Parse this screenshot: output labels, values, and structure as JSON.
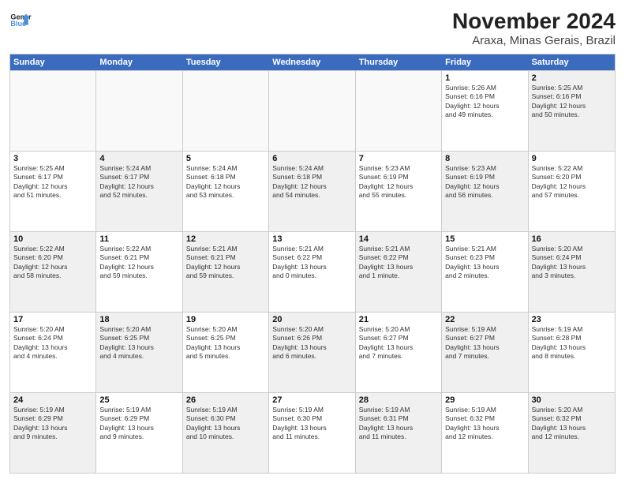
{
  "logo": {
    "line1": "General",
    "line2": "Blue"
  },
  "title": "November 2024",
  "subtitle": "Araxa, Minas Gerais, Brazil",
  "header_days": [
    "Sunday",
    "Monday",
    "Tuesday",
    "Wednesday",
    "Thursday",
    "Friday",
    "Saturday"
  ],
  "rows": [
    [
      {
        "day": "",
        "info": "",
        "shaded": false,
        "empty": true
      },
      {
        "day": "",
        "info": "",
        "shaded": false,
        "empty": true
      },
      {
        "day": "",
        "info": "",
        "shaded": false,
        "empty": true
      },
      {
        "day": "",
        "info": "",
        "shaded": false,
        "empty": true
      },
      {
        "day": "",
        "info": "",
        "shaded": false,
        "empty": true
      },
      {
        "day": "1",
        "info": "Sunrise: 5:26 AM\nSunset: 6:16 PM\nDaylight: 12 hours\nand 49 minutes.",
        "shaded": false,
        "empty": false
      },
      {
        "day": "2",
        "info": "Sunrise: 5:25 AM\nSunset: 6:16 PM\nDaylight: 12 hours\nand 50 minutes.",
        "shaded": true,
        "empty": false
      }
    ],
    [
      {
        "day": "3",
        "info": "Sunrise: 5:25 AM\nSunset: 6:17 PM\nDaylight: 12 hours\nand 51 minutes.",
        "shaded": false,
        "empty": false
      },
      {
        "day": "4",
        "info": "Sunrise: 5:24 AM\nSunset: 6:17 PM\nDaylight: 12 hours\nand 52 minutes.",
        "shaded": true,
        "empty": false
      },
      {
        "day": "5",
        "info": "Sunrise: 5:24 AM\nSunset: 6:18 PM\nDaylight: 12 hours\nand 53 minutes.",
        "shaded": false,
        "empty": false
      },
      {
        "day": "6",
        "info": "Sunrise: 5:24 AM\nSunset: 6:18 PM\nDaylight: 12 hours\nand 54 minutes.",
        "shaded": true,
        "empty": false
      },
      {
        "day": "7",
        "info": "Sunrise: 5:23 AM\nSunset: 6:19 PM\nDaylight: 12 hours\nand 55 minutes.",
        "shaded": false,
        "empty": false
      },
      {
        "day": "8",
        "info": "Sunrise: 5:23 AM\nSunset: 6:19 PM\nDaylight: 12 hours\nand 56 minutes.",
        "shaded": true,
        "empty": false
      },
      {
        "day": "9",
        "info": "Sunrise: 5:22 AM\nSunset: 6:20 PM\nDaylight: 12 hours\nand 57 minutes.",
        "shaded": false,
        "empty": false
      }
    ],
    [
      {
        "day": "10",
        "info": "Sunrise: 5:22 AM\nSunset: 6:20 PM\nDaylight: 12 hours\nand 58 minutes.",
        "shaded": true,
        "empty": false
      },
      {
        "day": "11",
        "info": "Sunrise: 5:22 AM\nSunset: 6:21 PM\nDaylight: 12 hours\nand 59 minutes.",
        "shaded": false,
        "empty": false
      },
      {
        "day": "12",
        "info": "Sunrise: 5:21 AM\nSunset: 6:21 PM\nDaylight: 12 hours\nand 59 minutes.",
        "shaded": true,
        "empty": false
      },
      {
        "day": "13",
        "info": "Sunrise: 5:21 AM\nSunset: 6:22 PM\nDaylight: 13 hours\nand 0 minutes.",
        "shaded": false,
        "empty": false
      },
      {
        "day": "14",
        "info": "Sunrise: 5:21 AM\nSunset: 6:22 PM\nDaylight: 13 hours\nand 1 minute.",
        "shaded": true,
        "empty": false
      },
      {
        "day": "15",
        "info": "Sunrise: 5:21 AM\nSunset: 6:23 PM\nDaylight: 13 hours\nand 2 minutes.",
        "shaded": false,
        "empty": false
      },
      {
        "day": "16",
        "info": "Sunrise: 5:20 AM\nSunset: 6:24 PM\nDaylight: 13 hours\nand 3 minutes.",
        "shaded": true,
        "empty": false
      }
    ],
    [
      {
        "day": "17",
        "info": "Sunrise: 5:20 AM\nSunset: 6:24 PM\nDaylight: 13 hours\nand 4 minutes.",
        "shaded": false,
        "empty": false
      },
      {
        "day": "18",
        "info": "Sunrise: 5:20 AM\nSunset: 6:25 PM\nDaylight: 13 hours\nand 4 minutes.",
        "shaded": true,
        "empty": false
      },
      {
        "day": "19",
        "info": "Sunrise: 5:20 AM\nSunset: 6:25 PM\nDaylight: 13 hours\nand 5 minutes.",
        "shaded": false,
        "empty": false
      },
      {
        "day": "20",
        "info": "Sunrise: 5:20 AM\nSunset: 6:26 PM\nDaylight: 13 hours\nand 6 minutes.",
        "shaded": true,
        "empty": false
      },
      {
        "day": "21",
        "info": "Sunrise: 5:20 AM\nSunset: 6:27 PM\nDaylight: 13 hours\nand 7 minutes.",
        "shaded": false,
        "empty": false
      },
      {
        "day": "22",
        "info": "Sunrise: 5:19 AM\nSunset: 6:27 PM\nDaylight: 13 hours\nand 7 minutes.",
        "shaded": true,
        "empty": false
      },
      {
        "day": "23",
        "info": "Sunrise: 5:19 AM\nSunset: 6:28 PM\nDaylight: 13 hours\nand 8 minutes.",
        "shaded": false,
        "empty": false
      }
    ],
    [
      {
        "day": "24",
        "info": "Sunrise: 5:19 AM\nSunset: 6:29 PM\nDaylight: 13 hours\nand 9 minutes.",
        "shaded": true,
        "empty": false
      },
      {
        "day": "25",
        "info": "Sunrise: 5:19 AM\nSunset: 6:29 PM\nDaylight: 13 hours\nand 9 minutes.",
        "shaded": false,
        "empty": false
      },
      {
        "day": "26",
        "info": "Sunrise: 5:19 AM\nSunset: 6:30 PM\nDaylight: 13 hours\nand 10 minutes.",
        "shaded": true,
        "empty": false
      },
      {
        "day": "27",
        "info": "Sunrise: 5:19 AM\nSunset: 6:30 PM\nDaylight: 13 hours\nand 11 minutes.",
        "shaded": false,
        "empty": false
      },
      {
        "day": "28",
        "info": "Sunrise: 5:19 AM\nSunset: 6:31 PM\nDaylight: 13 hours\nand 11 minutes.",
        "shaded": true,
        "empty": false
      },
      {
        "day": "29",
        "info": "Sunrise: 5:19 AM\nSunset: 6:32 PM\nDaylight: 13 hours\nand 12 minutes.",
        "shaded": false,
        "empty": false
      },
      {
        "day": "30",
        "info": "Sunrise: 5:20 AM\nSunset: 6:32 PM\nDaylight: 13 hours\nand 12 minutes.",
        "shaded": true,
        "empty": false
      }
    ]
  ]
}
